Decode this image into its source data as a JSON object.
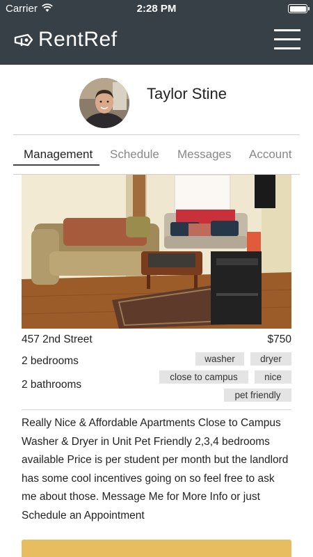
{
  "status_bar": {
    "carrier": "Carrier",
    "time": "2:28 PM"
  },
  "header": {
    "app_name": "RentRef",
    "logo_icon": "key-tag-icon",
    "menu_icon": "hamburger-menu-icon",
    "background_color": "#364046"
  },
  "profile": {
    "name": "Taylor Stine"
  },
  "tabs": [
    {
      "label": "Management",
      "active": true
    },
    {
      "label": "Schedule",
      "active": false
    },
    {
      "label": "Messages",
      "active": false
    },
    {
      "label": "Account",
      "active": false
    }
  ],
  "listing": {
    "address": "457 2nd Street",
    "price": "$750",
    "bedrooms": "2 bedrooms",
    "bathrooms": "2 bathrooms",
    "tags": [
      "washer",
      "dryer",
      "close to campus",
      "nice",
      "pet friendly"
    ],
    "description": "Really Nice & Affordable Apartments Close to Campus Washer & Dryer in Unit Pet Friendly 2,3,4 bedrooms available Price is per student per month but the landlord has some cool incentives going on so feel free to ask me about those. Message Me for More Info or just Schedule an Appointment"
  },
  "colors": {
    "accent": "#e8bd5f",
    "tag_bg": "#e4e4e4"
  }
}
